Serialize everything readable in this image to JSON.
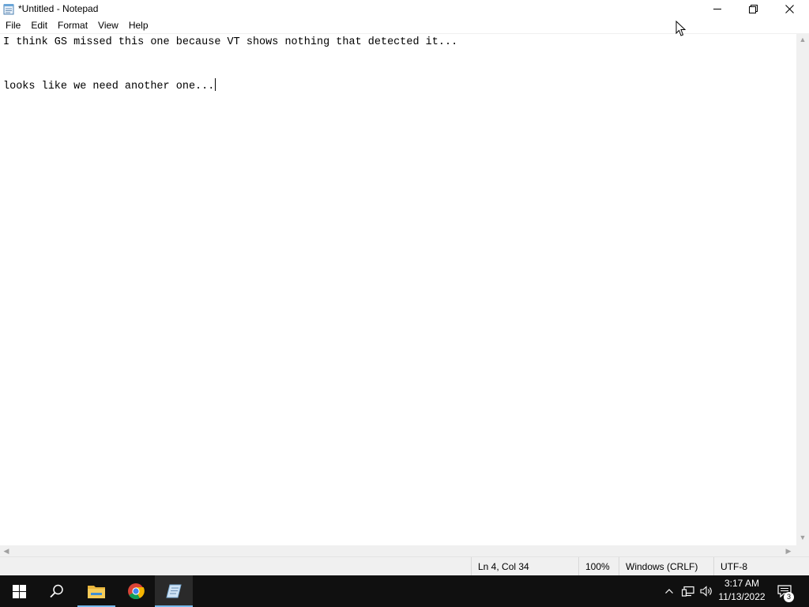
{
  "window": {
    "title": "*Untitled - Notepad",
    "icon": "notepad-icon"
  },
  "menu": {
    "items": [
      "File",
      "Edit",
      "Format",
      "View",
      "Help"
    ]
  },
  "editor": {
    "lines": [
      "I think GS missed this one because VT shows nothing that detected it...",
      "",
      "",
      "looks like we need another one..."
    ]
  },
  "status": {
    "position": "Ln 4, Col 34",
    "zoom": "100%",
    "line_ending": "Windows (CRLF)",
    "encoding": "UTF-8"
  },
  "taskbar": {
    "apps": [
      "start-icon",
      "search-icon",
      "file-explorer-icon",
      "chrome-icon",
      "notepad-icon"
    ],
    "active_app": "notepad-icon",
    "clock_time": "3:17 AM",
    "clock_date": "11/13/2022",
    "notification_count": "3"
  },
  "colors": {
    "taskbar_bg": "#101010",
    "accent": "#76b9ed",
    "statusbar_bg": "#f0f0f0"
  }
}
